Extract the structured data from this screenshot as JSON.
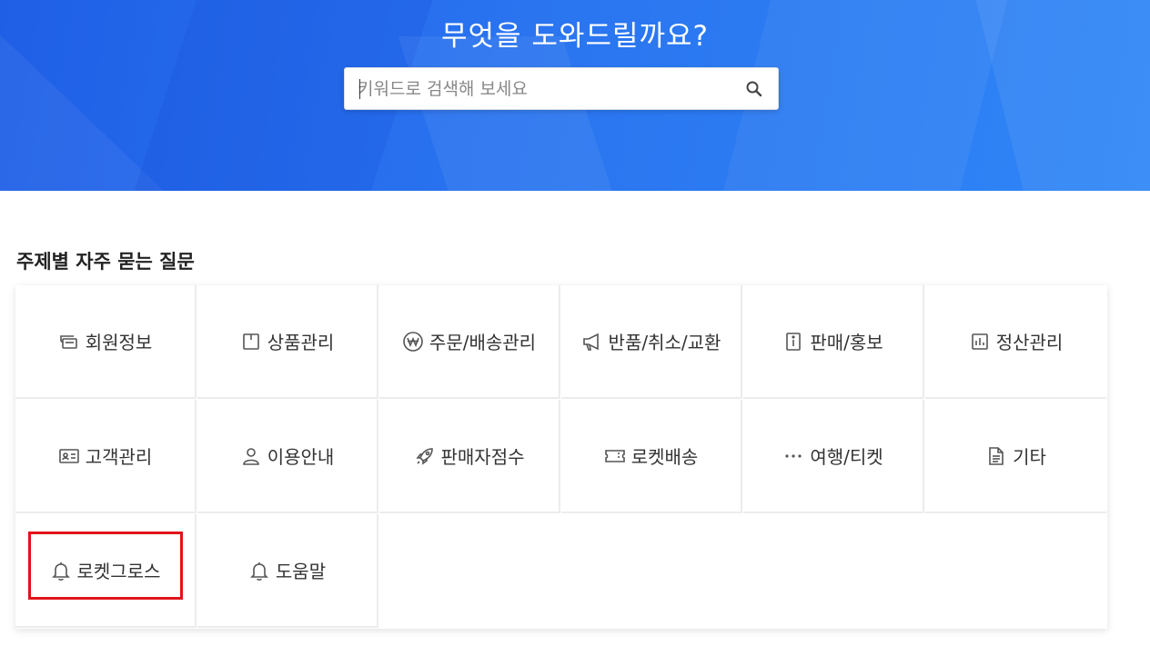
{
  "hero": {
    "title": "무엇을 도와드릴까요?",
    "search": {
      "placeholder": "키워드로 검색해 보세요",
      "value": "",
      "icon": "search-icon"
    }
  },
  "faq": {
    "section_title": "주제별 자주 묻는 질문",
    "categories": [
      {
        "label": "회원정보",
        "icon": "member-card-icon"
      },
      {
        "label": "상품관리",
        "icon": "box-icon"
      },
      {
        "label": "주문/배송관리",
        "icon": "won-coin-icon"
      },
      {
        "label": "반품/취소/교환",
        "icon": "megaphone-icon"
      },
      {
        "label": "판매/홍보",
        "icon": "info-icon"
      },
      {
        "label": "정산관리",
        "icon": "bar-chart-icon"
      },
      {
        "label": "고객관리",
        "icon": "id-card-icon"
      },
      {
        "label": "이용안내",
        "icon": "user-icon"
      },
      {
        "label": "판매자점수",
        "icon": "rocket-icon"
      },
      {
        "label": "로켓배송",
        "icon": "ticket-icon"
      },
      {
        "label": "여행/티켓",
        "icon": "more-dots-icon"
      },
      {
        "label": "기타",
        "icon": "document-icon"
      },
      {
        "label": "로켓그로스",
        "icon": "bell-icon"
      },
      {
        "label": "도움말",
        "icon": "bell-icon"
      }
    ],
    "highlight_color": "#e0141a"
  },
  "colors": {
    "hero_blue": "#2a74f0",
    "text": "#333333",
    "grid_line": "#ececec"
  }
}
